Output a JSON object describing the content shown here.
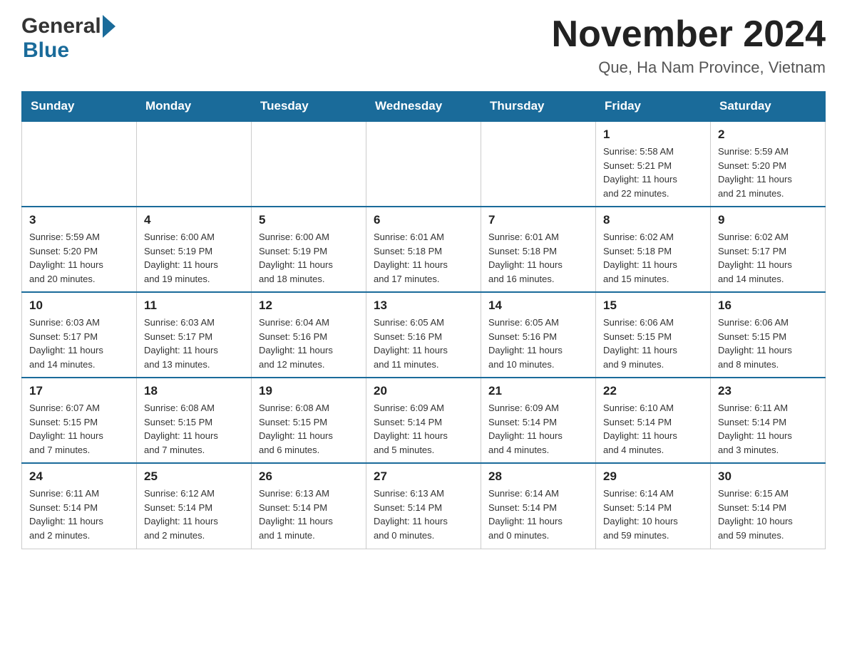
{
  "header": {
    "logo_general": "General",
    "logo_blue": "Blue",
    "title": "November 2024",
    "location": "Que, Ha Nam Province, Vietnam"
  },
  "days_of_week": [
    "Sunday",
    "Monday",
    "Tuesday",
    "Wednesday",
    "Thursday",
    "Friday",
    "Saturday"
  ],
  "weeks": [
    {
      "days": [
        {
          "number": "",
          "info": ""
        },
        {
          "number": "",
          "info": ""
        },
        {
          "number": "",
          "info": ""
        },
        {
          "number": "",
          "info": ""
        },
        {
          "number": "",
          "info": ""
        },
        {
          "number": "1",
          "info": "Sunrise: 5:58 AM\nSunset: 5:21 PM\nDaylight: 11 hours\nand 22 minutes."
        },
        {
          "number": "2",
          "info": "Sunrise: 5:59 AM\nSunset: 5:20 PM\nDaylight: 11 hours\nand 21 minutes."
        }
      ]
    },
    {
      "days": [
        {
          "number": "3",
          "info": "Sunrise: 5:59 AM\nSunset: 5:20 PM\nDaylight: 11 hours\nand 20 minutes."
        },
        {
          "number": "4",
          "info": "Sunrise: 6:00 AM\nSunset: 5:19 PM\nDaylight: 11 hours\nand 19 minutes."
        },
        {
          "number": "5",
          "info": "Sunrise: 6:00 AM\nSunset: 5:19 PM\nDaylight: 11 hours\nand 18 minutes."
        },
        {
          "number": "6",
          "info": "Sunrise: 6:01 AM\nSunset: 5:18 PM\nDaylight: 11 hours\nand 17 minutes."
        },
        {
          "number": "7",
          "info": "Sunrise: 6:01 AM\nSunset: 5:18 PM\nDaylight: 11 hours\nand 16 minutes."
        },
        {
          "number": "8",
          "info": "Sunrise: 6:02 AM\nSunset: 5:18 PM\nDaylight: 11 hours\nand 15 minutes."
        },
        {
          "number": "9",
          "info": "Sunrise: 6:02 AM\nSunset: 5:17 PM\nDaylight: 11 hours\nand 14 minutes."
        }
      ]
    },
    {
      "days": [
        {
          "number": "10",
          "info": "Sunrise: 6:03 AM\nSunset: 5:17 PM\nDaylight: 11 hours\nand 14 minutes."
        },
        {
          "number": "11",
          "info": "Sunrise: 6:03 AM\nSunset: 5:17 PM\nDaylight: 11 hours\nand 13 minutes."
        },
        {
          "number": "12",
          "info": "Sunrise: 6:04 AM\nSunset: 5:16 PM\nDaylight: 11 hours\nand 12 minutes."
        },
        {
          "number": "13",
          "info": "Sunrise: 6:05 AM\nSunset: 5:16 PM\nDaylight: 11 hours\nand 11 minutes."
        },
        {
          "number": "14",
          "info": "Sunrise: 6:05 AM\nSunset: 5:16 PM\nDaylight: 11 hours\nand 10 minutes."
        },
        {
          "number": "15",
          "info": "Sunrise: 6:06 AM\nSunset: 5:15 PM\nDaylight: 11 hours\nand 9 minutes."
        },
        {
          "number": "16",
          "info": "Sunrise: 6:06 AM\nSunset: 5:15 PM\nDaylight: 11 hours\nand 8 minutes."
        }
      ]
    },
    {
      "days": [
        {
          "number": "17",
          "info": "Sunrise: 6:07 AM\nSunset: 5:15 PM\nDaylight: 11 hours\nand 7 minutes."
        },
        {
          "number": "18",
          "info": "Sunrise: 6:08 AM\nSunset: 5:15 PM\nDaylight: 11 hours\nand 7 minutes."
        },
        {
          "number": "19",
          "info": "Sunrise: 6:08 AM\nSunset: 5:15 PM\nDaylight: 11 hours\nand 6 minutes."
        },
        {
          "number": "20",
          "info": "Sunrise: 6:09 AM\nSunset: 5:14 PM\nDaylight: 11 hours\nand 5 minutes."
        },
        {
          "number": "21",
          "info": "Sunrise: 6:09 AM\nSunset: 5:14 PM\nDaylight: 11 hours\nand 4 minutes."
        },
        {
          "number": "22",
          "info": "Sunrise: 6:10 AM\nSunset: 5:14 PM\nDaylight: 11 hours\nand 4 minutes."
        },
        {
          "number": "23",
          "info": "Sunrise: 6:11 AM\nSunset: 5:14 PM\nDaylight: 11 hours\nand 3 minutes."
        }
      ]
    },
    {
      "days": [
        {
          "number": "24",
          "info": "Sunrise: 6:11 AM\nSunset: 5:14 PM\nDaylight: 11 hours\nand 2 minutes."
        },
        {
          "number": "25",
          "info": "Sunrise: 6:12 AM\nSunset: 5:14 PM\nDaylight: 11 hours\nand 2 minutes."
        },
        {
          "number": "26",
          "info": "Sunrise: 6:13 AM\nSunset: 5:14 PM\nDaylight: 11 hours\nand 1 minute."
        },
        {
          "number": "27",
          "info": "Sunrise: 6:13 AM\nSunset: 5:14 PM\nDaylight: 11 hours\nand 0 minutes."
        },
        {
          "number": "28",
          "info": "Sunrise: 6:14 AM\nSunset: 5:14 PM\nDaylight: 11 hours\nand 0 minutes."
        },
        {
          "number": "29",
          "info": "Sunrise: 6:14 AM\nSunset: 5:14 PM\nDaylight: 10 hours\nand 59 minutes."
        },
        {
          "number": "30",
          "info": "Sunrise: 6:15 AM\nSunset: 5:14 PM\nDaylight: 10 hours\nand 59 minutes."
        }
      ]
    }
  ]
}
